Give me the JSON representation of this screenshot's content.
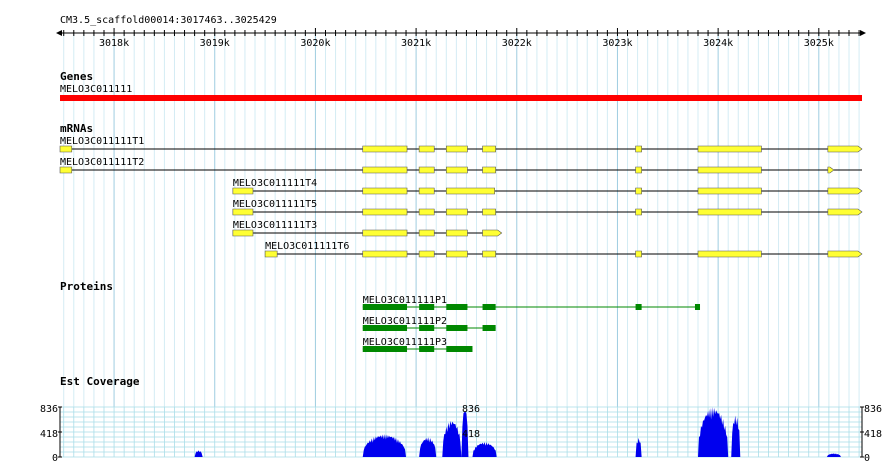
{
  "ruler": {
    "label": "CM3.5_scaffold00014:3017463..3025429",
    "ticks": [
      {
        "kb": 3018,
        "label": "3018k"
      },
      {
        "kb": 3019,
        "label": "3019k"
      },
      {
        "kb": 3020,
        "label": "3020k"
      },
      {
        "kb": 3021,
        "label": "3021k"
      },
      {
        "kb": 3022,
        "label": "3022k"
      },
      {
        "kb": 3023,
        "label": "3023k"
      },
      {
        "kb": 3024,
        "label": "3024k"
      },
      {
        "kb": 3025,
        "label": "3025k"
      }
    ],
    "start": 3017463,
    "end": 3025429
  },
  "tracks": {
    "genes": {
      "title": "Genes",
      "items": [
        {
          "name": "MELO3C011111",
          "start": 3017463,
          "end": 3025429,
          "color": "#ff0000"
        }
      ]
    },
    "mrnas": {
      "title": "mRNAs",
      "exon_color": "#ffff33",
      "items": [
        {
          "name": "MELO3C011111T1",
          "start": 3017463,
          "end": 3025429,
          "exons": [
            [
              3017463,
              3017580
            ],
            [
              3020470,
              3020910
            ],
            [
              3021030,
              3021180
            ],
            [
              3021300,
              3021510
            ],
            [
              3021660,
              3021790
            ],
            [
              3023180,
              3023240
            ],
            [
              3023800,
              3024430
            ],
            [
              3025090,
              3025429
            ]
          ]
        },
        {
          "name": "MELO3C011111T2",
          "start": 3017463,
          "end": 3025429,
          "exons": [
            [
              3017463,
              3017580
            ],
            [
              3020470,
              3020910
            ],
            [
              3021030,
              3021180
            ],
            [
              3021300,
              3021510
            ],
            [
              3021660,
              3021790
            ],
            [
              3023180,
              3023240
            ],
            [
              3023800,
              3024430
            ],
            [
              3025090,
              3025150
            ]
          ]
        },
        {
          "name": "MELO3C011111T4",
          "start": 3019180,
          "end": 3025429,
          "exons": [
            [
              3019180,
              3019380
            ],
            [
              3020470,
              3020910
            ],
            [
              3021030,
              3021180
            ],
            [
              3021300,
              3021780
            ],
            [
              3023180,
              3023240
            ],
            [
              3023800,
              3024430
            ],
            [
              3025090,
              3025429
            ]
          ]
        },
        {
          "name": "MELO3C011111T5",
          "start": 3019180,
          "end": 3025429,
          "exons": [
            [
              3019180,
              3019380
            ],
            [
              3020470,
              3020910
            ],
            [
              3021030,
              3021180
            ],
            [
              3021300,
              3021510
            ],
            [
              3021660,
              3021790
            ],
            [
              3023180,
              3023240
            ],
            [
              3023800,
              3024430
            ],
            [
              3025090,
              3025429
            ]
          ]
        },
        {
          "name": "MELO3C011111T3",
          "start": 3019180,
          "end": 3021850,
          "exons": [
            [
              3019180,
              3019380
            ],
            [
              3020470,
              3020910
            ],
            [
              3021030,
              3021180
            ],
            [
              3021300,
              3021510
            ],
            [
              3021660,
              3021850
            ]
          ]
        },
        {
          "name": "MELO3C011111T6",
          "start": 3019500,
          "end": 3025429,
          "exons": [
            [
              3019500,
              3019620
            ],
            [
              3020470,
              3020910
            ],
            [
              3021030,
              3021180
            ],
            [
              3021300,
              3021510
            ],
            [
              3021660,
              3021790
            ],
            [
              3023180,
              3023240
            ],
            [
              3023800,
              3024430
            ],
            [
              3025090,
              3025429
            ]
          ]
        }
      ]
    },
    "proteins": {
      "title": "Proteins",
      "color": "#008800",
      "items": [
        {
          "name": "MELO3C011111P1",
          "start": 3020470,
          "end": 3023820,
          "exons": [
            [
              3020470,
              3020910
            ],
            [
              3021030,
              3021180
            ],
            [
              3021300,
              3021510
            ],
            [
              3021660,
              3021790
            ],
            [
              3023180,
              3023240
            ],
            [
              3023770,
              3023820
            ]
          ]
        },
        {
          "name": "MELO3C011111P2",
          "start": 3020470,
          "end": 3021790,
          "exons": [
            [
              3020470,
              3020910
            ],
            [
              3021030,
              3021180
            ],
            [
              3021300,
              3021510
            ],
            [
              3021660,
              3021790
            ]
          ]
        },
        {
          "name": "MELO3C011111P3",
          "start": 3020470,
          "end": 3021560,
          "exons": [
            [
              3020470,
              3020910
            ],
            [
              3021030,
              3021180
            ],
            [
              3021300,
              3021560
            ]
          ]
        }
      ]
    },
    "est": {
      "title": "Est Coverage",
      "max_label": "836",
      "mid_label": "418",
      "zero_label": "0",
      "max": 836,
      "inner_labels": [
        "836",
        "418"
      ],
      "color": "#0000ee",
      "peaks": [
        {
          "start": 3018800,
          "end": 3018880,
          "height": 110
        },
        {
          "start": 3020470,
          "end": 3020900,
          "height": 380
        },
        {
          "start": 3021030,
          "end": 3021200,
          "height": 330
        },
        {
          "start": 3021260,
          "end": 3021450,
          "height": 620
        },
        {
          "start": 3021450,
          "end": 3021520,
          "height": 836
        },
        {
          "start": 3021560,
          "end": 3021800,
          "height": 250
        },
        {
          "start": 3023180,
          "end": 3023240,
          "height": 320
        },
        {
          "start": 3023800,
          "end": 3024100,
          "height": 836
        },
        {
          "start": 3024130,
          "end": 3024220,
          "height": 700
        },
        {
          "start": 3025080,
          "end": 3025220,
          "height": 60
        }
      ]
    }
  }
}
